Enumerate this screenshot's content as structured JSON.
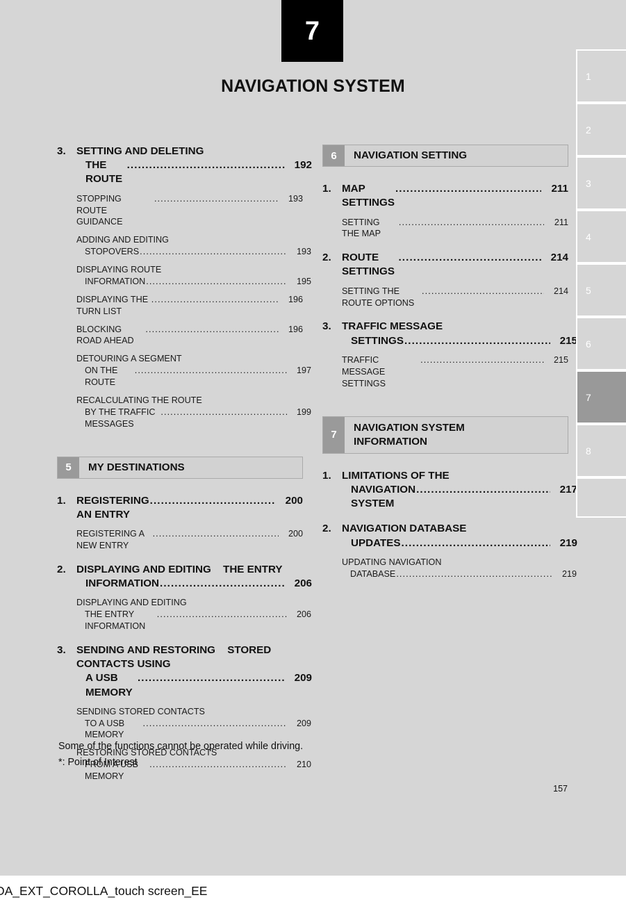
{
  "chapter": {
    "number": "7",
    "title": "NAVIGATION SYSTEM"
  },
  "left_column": {
    "continued_entry": {
      "num": "3.",
      "line1": "SETTING AND DELETING",
      "line2": "THE ROUTE",
      "page": "192",
      "sub_entries": [
        {
          "line1": "STOPPING ROUTE GUIDANCE",
          "line2": "",
          "page": "193"
        },
        {
          "line1": "ADDING AND EDITING",
          "line2": "STOPOVERS",
          "page": "193"
        },
        {
          "line1": "DISPLAYING ROUTE",
          "line2": "INFORMATION",
          "page": "195"
        },
        {
          "line1": "DISPLAYING THE TURN LIST",
          "line2": "",
          "page": "196"
        },
        {
          "line1": "BLOCKING ROAD AHEAD",
          "line2": "",
          "page": "196"
        },
        {
          "line1": "DETOURING A SEGMENT",
          "line2": "ON THE ROUTE",
          "page": "197"
        },
        {
          "line1": "RECALCULATING THE ROUTE",
          "line2": "BY THE TRAFFIC MESSAGES",
          "page": "199"
        }
      ]
    },
    "section": {
      "number": "5",
      "title": "MY DESTINATIONS",
      "entries": [
        {
          "num": "1.",
          "lines": [
            "REGISTERING AN ENTRY"
          ],
          "page": "200",
          "sub_entries": [
            {
              "line1": "REGISTERING A NEW ENTRY",
              "line2": "",
              "page": "200"
            }
          ]
        },
        {
          "num": "2.",
          "lines": [
            "DISPLAYING AND EDITING",
            "THE ENTRY",
            "INFORMATION"
          ],
          "page": "206",
          "sub_entries": [
            {
              "line1": "DISPLAYING AND EDITING",
              "line2": "THE ENTRY INFORMATION",
              "page": "206"
            }
          ]
        },
        {
          "num": "3.",
          "lines": [
            "SENDING AND RESTORING",
            "STORED CONTACTS USING",
            "A USB MEMORY"
          ],
          "page": "209",
          "sub_entries": [
            {
              "line1": "SENDING STORED CONTACTS",
              "line2": "TO A USB MEMORY",
              "page": "209"
            },
            {
              "line1": "RESTORING STORED CONTACTS",
              "line2": "FROM A USB MEMORY",
              "page": "210"
            }
          ]
        }
      ]
    }
  },
  "right_column": {
    "sections": [
      {
        "number": "6",
        "title_line1": "NAVIGATION SETTING",
        "title_line2": "",
        "entries": [
          {
            "num": "1.",
            "lines": [
              "MAP SETTINGS"
            ],
            "page": "211",
            "sub_entries": [
              {
                "line1": "SETTING THE MAP",
                "line2": "",
                "page": "211"
              }
            ]
          },
          {
            "num": "2.",
            "lines": [
              "ROUTE SETTINGS"
            ],
            "page": "214",
            "sub_entries": [
              {
                "line1": "SETTING THE ROUTE OPTIONS",
                "line2": "",
                "page": "214"
              }
            ]
          },
          {
            "num": "3.",
            "lines": [
              "TRAFFIC MESSAGE",
              "SETTINGS"
            ],
            "page": "215",
            "sub_entries": [
              {
                "line1": "TRAFFIC MESSAGE SETTINGS",
                "line2": "",
                "page": "215"
              }
            ]
          }
        ]
      },
      {
        "number": "7",
        "title_line1": "NAVIGATION SYSTEM",
        "title_line2": "INFORMATION",
        "entries": [
          {
            "num": "1.",
            "lines": [
              "LIMITATIONS OF THE",
              "NAVIGATION SYSTEM"
            ],
            "page": "217",
            "sub_entries": []
          },
          {
            "num": "2.",
            "lines": [
              "NAVIGATION DATABASE",
              "UPDATES"
            ],
            "page": "219",
            "sub_entries": [
              {
                "line1": "UPDATING NAVIGATION",
                "line2": "DATABASE",
                "page": "219"
              }
            ]
          }
        ]
      }
    ]
  },
  "tab_strip": {
    "items": [
      "1",
      "2",
      "3",
      "4",
      "5",
      "6",
      "7",
      "8"
    ],
    "active": "7",
    "active_color": "#999999",
    "inactive_color": "#d6d6d6"
  },
  "notes": [
    "Some of the functions cannot be operated while driving.",
    "*: Point of Interest"
  ],
  "page_number": "157",
  "sheet_caption": "DA_EXT_COROLLA_touch screen_EE",
  "colors": {
    "page_background": "#d6d6d6",
    "chapter_badge": "#000000",
    "section_badge": "#9a9a9a",
    "section_bar": "#d2d2d2",
    "text": "#111111"
  }
}
